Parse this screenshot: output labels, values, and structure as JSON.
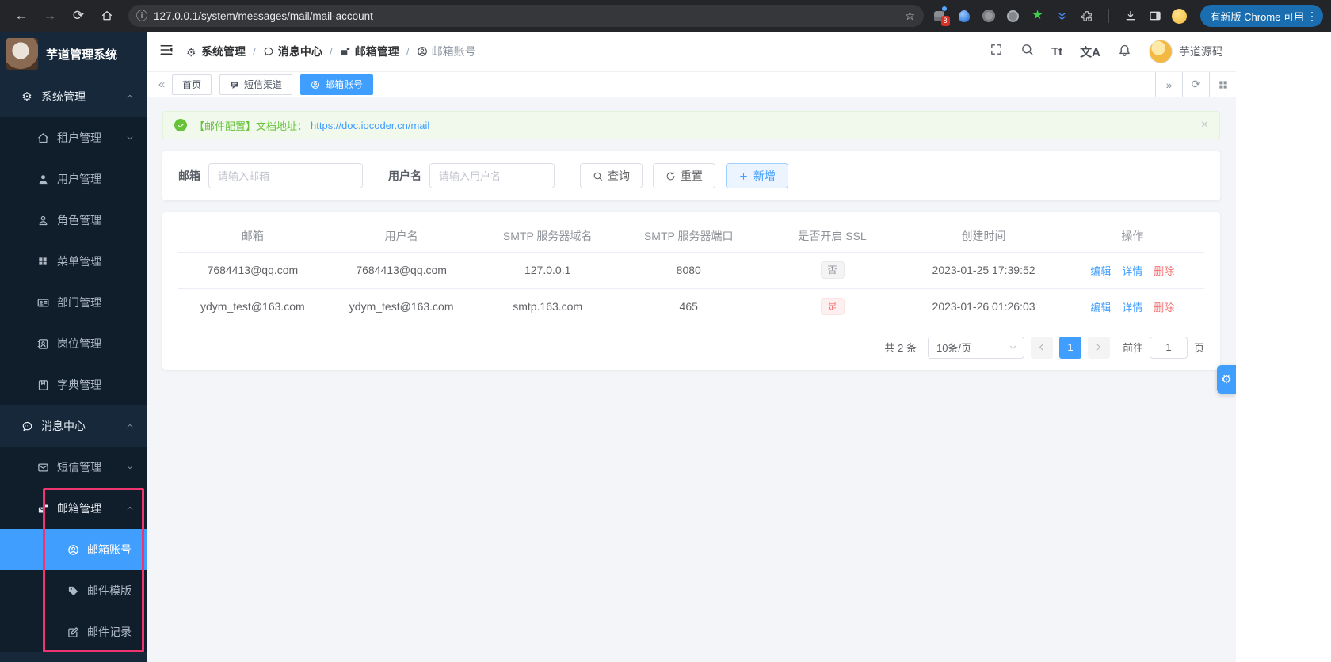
{
  "browser": {
    "url": "127.0.0.1/system/messages/mail/mail-account",
    "update_button": "有新版 Chrome 可用",
    "ext_badge": "8"
  },
  "glyphs": {
    "back": "←",
    "forward": "→",
    "reload": "⟳",
    "info": "ⓘ",
    "star": "☆",
    "overflow": "⋮",
    "gear": "⚙",
    "green_star": "★",
    "tt": "Tt",
    "translate": "文A",
    "close": "×",
    "chev_left": "«",
    "chev_right": "»"
  },
  "app": {
    "title": "芋道管理系统",
    "username": "芋道源码"
  },
  "sidebar": {
    "items": [
      {
        "label": "系统管理"
      },
      {
        "label": "租户管理"
      },
      {
        "label": "用户管理"
      },
      {
        "label": "角色管理"
      },
      {
        "label": "菜单管理"
      },
      {
        "label": "部门管理"
      },
      {
        "label": "岗位管理"
      },
      {
        "label": "字典管理"
      },
      {
        "label": "消息中心"
      },
      {
        "label": "短信管理"
      },
      {
        "label": "邮箱管理"
      },
      {
        "label": "邮箱账号"
      },
      {
        "label": "邮件模版"
      },
      {
        "label": "邮件记录"
      }
    ]
  },
  "breadcrumb": {
    "separator": "/",
    "items": [
      {
        "label": "系统管理"
      },
      {
        "label": "消息中心"
      },
      {
        "label": "邮箱管理"
      },
      {
        "label": "邮箱账号"
      }
    ]
  },
  "tabs": {
    "items": [
      {
        "label": "首页"
      },
      {
        "label": "短信渠道"
      },
      {
        "label": "邮箱账号"
      }
    ]
  },
  "alert": {
    "message": "【邮件配置】文档地址：",
    "link": "https://doc.iocoder.cn/mail"
  },
  "search": {
    "email_label": "邮箱",
    "email_placeholder": "请输入邮箱",
    "username_label": "用户名",
    "username_placeholder": "请输入用户名",
    "query_label": "查询",
    "reset_label": "重置",
    "add_label": "新增"
  },
  "table": {
    "headers": [
      "邮箱",
      "用户名",
      "SMTP 服务器域名",
      "SMTP 服务器端口",
      "是否开启 SSL",
      "创建时间",
      "操作"
    ],
    "rows": [
      {
        "email": "7684413@qq.com",
        "username": "7684413@qq.com",
        "host": "127.0.0.1",
        "port": "8080",
        "ssl": "否",
        "created": "2023-01-25 17:39:52"
      },
      {
        "email": "ydym_test@163.com",
        "username": "ydym_test@163.com",
        "host": "smtp.163.com",
        "port": "465",
        "ssl": "是",
        "created": "2023-01-26 01:26:03"
      }
    ],
    "actions": {
      "edit": "编辑",
      "detail": "详情",
      "remove": "删除"
    }
  },
  "pagination": {
    "total": "共 2 条",
    "page_size": "10条/页",
    "current": "1",
    "goto_label": "前往",
    "goto_value": "1",
    "unit": "页"
  },
  "colors": {
    "primary": "#409eff",
    "success": "#67c23a",
    "danger": "#f56c6c",
    "annotation_box": "#ee3570",
    "sidebar_bg": "#17283b",
    "sidebar_sub_bg": "#101d2b"
  }
}
